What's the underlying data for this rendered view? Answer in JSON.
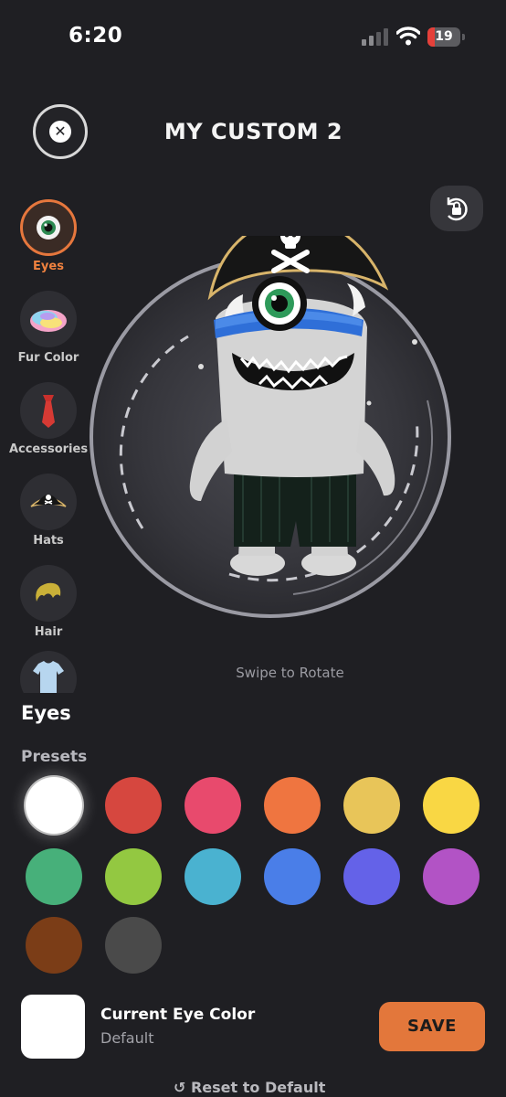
{
  "status": {
    "time": "6:20",
    "battery": "19"
  },
  "header": {
    "title": "MY CUSTOM 2"
  },
  "sidebar": {
    "items": [
      {
        "label": "Eyes",
        "icon": "eye-icon",
        "active": true
      },
      {
        "label": "Fur Color",
        "icon": "fur-color-icon",
        "active": false
      },
      {
        "label": "Accessories",
        "icon": "necktie-icon",
        "active": false
      },
      {
        "label": "Hats",
        "icon": "pirate-hat-icon",
        "active": false
      },
      {
        "label": "Hair",
        "icon": "hair-icon",
        "active": false
      },
      {
        "label": "",
        "icon": "shirt-icon",
        "active": false
      }
    ]
  },
  "stage": {
    "hint": "Swipe to Rotate"
  },
  "section": {
    "title": "Eyes",
    "presets_label": "Presets"
  },
  "presets": [
    {
      "color": "#ffffff",
      "selected": true
    },
    {
      "color": "#d6473f"
    },
    {
      "color": "#e84a6d"
    },
    {
      "color": "#ef7540"
    },
    {
      "color": "#e8c559"
    },
    {
      "color": "#f9d744"
    },
    {
      "color": "#47b07a"
    },
    {
      "color": "#93c841"
    },
    {
      "color": "#4ab2d0"
    },
    {
      "color": "#4a7ee8"
    },
    {
      "color": "#6462e8"
    },
    {
      "color": "#b253c5"
    },
    {
      "color": "#7b3d17"
    },
    {
      "color": "#4a4a4a"
    }
  ],
  "current": {
    "label": "Current Eye Color",
    "value": "Default",
    "color": "#ffffff"
  },
  "actions": {
    "save_label": "SAVE",
    "reset_label": "Reset to Default"
  },
  "colors": {
    "accent": "#e3773b",
    "background": "#1f1f23"
  }
}
